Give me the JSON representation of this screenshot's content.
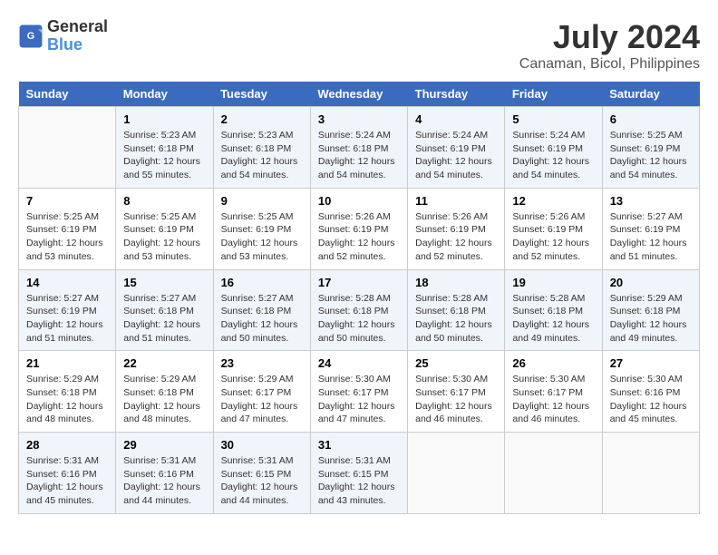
{
  "app": {
    "name": "GeneralBlue",
    "logo_text_1": "General",
    "logo_text_2": "Blue"
  },
  "calendar": {
    "title": "July 2024",
    "subtitle": "Canaman, Bicol, Philippines",
    "days_of_week": [
      "Sunday",
      "Monday",
      "Tuesday",
      "Wednesday",
      "Thursday",
      "Friday",
      "Saturday"
    ],
    "weeks": [
      [
        {
          "day": "",
          "info": ""
        },
        {
          "day": "1",
          "info": "Sunrise: 5:23 AM\nSunset: 6:18 PM\nDaylight: 12 hours\nand 55 minutes."
        },
        {
          "day": "2",
          "info": "Sunrise: 5:23 AM\nSunset: 6:18 PM\nDaylight: 12 hours\nand 54 minutes."
        },
        {
          "day": "3",
          "info": "Sunrise: 5:24 AM\nSunset: 6:18 PM\nDaylight: 12 hours\nand 54 minutes."
        },
        {
          "day": "4",
          "info": "Sunrise: 5:24 AM\nSunset: 6:19 PM\nDaylight: 12 hours\nand 54 minutes."
        },
        {
          "day": "5",
          "info": "Sunrise: 5:24 AM\nSunset: 6:19 PM\nDaylight: 12 hours\nand 54 minutes."
        },
        {
          "day": "6",
          "info": "Sunrise: 5:25 AM\nSunset: 6:19 PM\nDaylight: 12 hours\nand 54 minutes."
        }
      ],
      [
        {
          "day": "7",
          "info": "Sunrise: 5:25 AM\nSunset: 6:19 PM\nDaylight: 12 hours\nand 53 minutes."
        },
        {
          "day": "8",
          "info": "Sunrise: 5:25 AM\nSunset: 6:19 PM\nDaylight: 12 hours\nand 53 minutes."
        },
        {
          "day": "9",
          "info": "Sunrise: 5:25 AM\nSunset: 6:19 PM\nDaylight: 12 hours\nand 53 minutes."
        },
        {
          "day": "10",
          "info": "Sunrise: 5:26 AM\nSunset: 6:19 PM\nDaylight: 12 hours\nand 52 minutes."
        },
        {
          "day": "11",
          "info": "Sunrise: 5:26 AM\nSunset: 6:19 PM\nDaylight: 12 hours\nand 52 minutes."
        },
        {
          "day": "12",
          "info": "Sunrise: 5:26 AM\nSunset: 6:19 PM\nDaylight: 12 hours\nand 52 minutes."
        },
        {
          "day": "13",
          "info": "Sunrise: 5:27 AM\nSunset: 6:19 PM\nDaylight: 12 hours\nand 51 minutes."
        }
      ],
      [
        {
          "day": "14",
          "info": "Sunrise: 5:27 AM\nSunset: 6:19 PM\nDaylight: 12 hours\nand 51 minutes."
        },
        {
          "day": "15",
          "info": "Sunrise: 5:27 AM\nSunset: 6:18 PM\nDaylight: 12 hours\nand 51 minutes."
        },
        {
          "day": "16",
          "info": "Sunrise: 5:27 AM\nSunset: 6:18 PM\nDaylight: 12 hours\nand 50 minutes."
        },
        {
          "day": "17",
          "info": "Sunrise: 5:28 AM\nSunset: 6:18 PM\nDaylight: 12 hours\nand 50 minutes."
        },
        {
          "day": "18",
          "info": "Sunrise: 5:28 AM\nSunset: 6:18 PM\nDaylight: 12 hours\nand 50 minutes."
        },
        {
          "day": "19",
          "info": "Sunrise: 5:28 AM\nSunset: 6:18 PM\nDaylight: 12 hours\nand 49 minutes."
        },
        {
          "day": "20",
          "info": "Sunrise: 5:29 AM\nSunset: 6:18 PM\nDaylight: 12 hours\nand 49 minutes."
        }
      ],
      [
        {
          "day": "21",
          "info": "Sunrise: 5:29 AM\nSunset: 6:18 PM\nDaylight: 12 hours\nand 48 minutes."
        },
        {
          "day": "22",
          "info": "Sunrise: 5:29 AM\nSunset: 6:18 PM\nDaylight: 12 hours\nand 48 minutes."
        },
        {
          "day": "23",
          "info": "Sunrise: 5:29 AM\nSunset: 6:17 PM\nDaylight: 12 hours\nand 47 minutes."
        },
        {
          "day": "24",
          "info": "Sunrise: 5:30 AM\nSunset: 6:17 PM\nDaylight: 12 hours\nand 47 minutes."
        },
        {
          "day": "25",
          "info": "Sunrise: 5:30 AM\nSunset: 6:17 PM\nDaylight: 12 hours\nand 46 minutes."
        },
        {
          "day": "26",
          "info": "Sunrise: 5:30 AM\nSunset: 6:17 PM\nDaylight: 12 hours\nand 46 minutes."
        },
        {
          "day": "27",
          "info": "Sunrise: 5:30 AM\nSunset: 6:16 PM\nDaylight: 12 hours\nand 45 minutes."
        }
      ],
      [
        {
          "day": "28",
          "info": "Sunrise: 5:31 AM\nSunset: 6:16 PM\nDaylight: 12 hours\nand 45 minutes."
        },
        {
          "day": "29",
          "info": "Sunrise: 5:31 AM\nSunset: 6:16 PM\nDaylight: 12 hours\nand 44 minutes."
        },
        {
          "day": "30",
          "info": "Sunrise: 5:31 AM\nSunset: 6:15 PM\nDaylight: 12 hours\nand 44 minutes."
        },
        {
          "day": "31",
          "info": "Sunrise: 5:31 AM\nSunset: 6:15 PM\nDaylight: 12 hours\nand 43 minutes."
        },
        {
          "day": "",
          "info": ""
        },
        {
          "day": "",
          "info": ""
        },
        {
          "day": "",
          "info": ""
        }
      ]
    ]
  }
}
